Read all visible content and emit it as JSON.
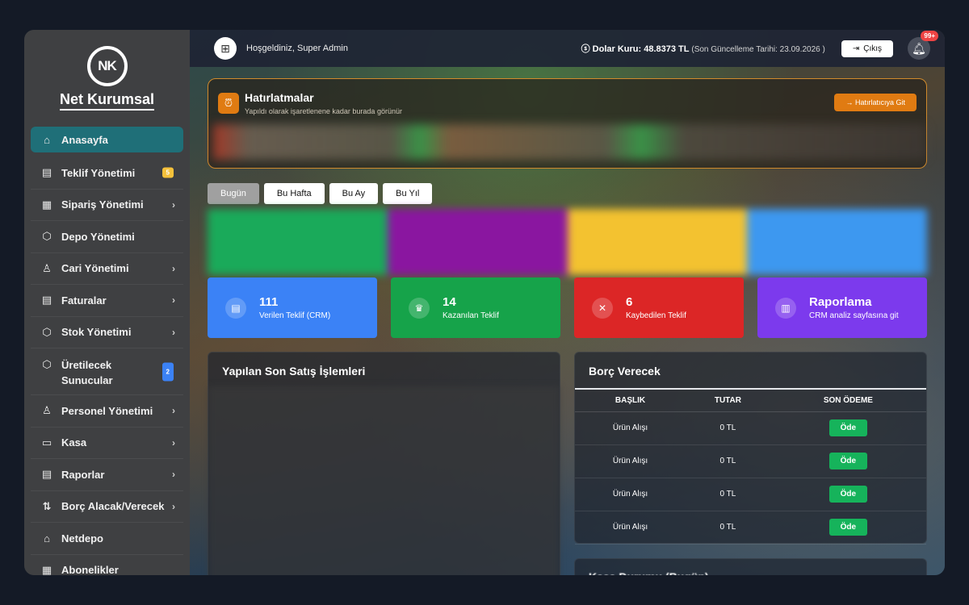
{
  "brand": {
    "logo_initials": "NK",
    "name": "Net Kurumsal"
  },
  "sidebar": {
    "items": [
      {
        "label": "Anasayfa",
        "icon": "home-icon",
        "glyph": "⌂",
        "active": true
      },
      {
        "label": "Teklif Yönetimi",
        "icon": "document-icon",
        "glyph": "▤",
        "badge": "5",
        "badge_color": "yellow"
      },
      {
        "label": "Sipariş Yönetimi",
        "icon": "clipboard-icon",
        "glyph": "▦",
        "chevron": true
      },
      {
        "label": "Depo Yönetimi",
        "icon": "box-icon",
        "glyph": "⬡"
      },
      {
        "label": "Cari Yönetimi",
        "icon": "user-icon",
        "glyph": "♙",
        "chevron": true
      },
      {
        "label": "Faturalar",
        "icon": "invoice-icon",
        "glyph": "▤",
        "chevron": true
      },
      {
        "label": "Stok Yönetimi",
        "icon": "box-icon",
        "glyph": "⬡",
        "chevron": true
      },
      {
        "label": "Üretilecek Sunucular",
        "icon": "cube-icon",
        "glyph": "⬡",
        "badge": "2",
        "badge_color": "blue",
        "tall": true
      },
      {
        "label": "Personel Yönetimi",
        "icon": "users-icon",
        "glyph": "♙",
        "chevron": true
      },
      {
        "label": "Kasa",
        "icon": "wallet-icon",
        "glyph": "▭",
        "chevron": true
      },
      {
        "label": "Raporlar",
        "icon": "report-icon",
        "glyph": "▤",
        "chevron": true
      },
      {
        "label": "Borç Alacak/Verecek",
        "icon": "transfer-icon",
        "glyph": "⇅",
        "chevron": true
      },
      {
        "label": "Netdepo",
        "icon": "store-icon",
        "glyph": "⌂"
      },
      {
        "label": "Abonelikler",
        "icon": "calendar-icon",
        "glyph": "▦"
      }
    ]
  },
  "topbar": {
    "welcome": "Hoşgeldiniz, Super Admin",
    "rate_label": "Dolar Kuru: 48.8373 TL",
    "rate_updated": "(Son Güncelleme Tarihi: 23.09.2026 )",
    "logout": "Çıkış",
    "notification_count": "99+"
  },
  "reminders": {
    "title": "Hatırlatmalar",
    "subtitle": "Yapıldı olarak işaretlenene kadar burada görünür",
    "button": "Hatırlatıcıya Git"
  },
  "filters": [
    "Bugün",
    "Bu Hafta",
    "Bu Ay",
    "Bu Yıl"
  ],
  "active_filter": 0,
  "blurred_cards": [
    "#1aaa5a",
    "#8a16a0",
    "#f3c230",
    "#3d98f0"
  ],
  "stats": [
    {
      "value": "111",
      "label": "Verilen Teklif (CRM)",
      "color": "#3b82f6",
      "icon": "document-icon",
      "glyph": "▤"
    },
    {
      "value": "14",
      "label": "Kazanılan Teklif",
      "color": "#16a34a",
      "icon": "trophy-icon",
      "glyph": "♛"
    },
    {
      "value": "6",
      "label": "Kaybedilen Teklif",
      "color": "#dc2626",
      "icon": "x-circle-icon",
      "glyph": "✕"
    },
    {
      "value": "Raporlama",
      "label": "CRM analiz sayfasına git",
      "color": "#7c3aed",
      "icon": "chart-icon",
      "glyph": "▥"
    }
  ],
  "sales": {
    "title": "Yapılan Son Satış İşlemleri"
  },
  "debt": {
    "title": "Borç Verecek",
    "columns": [
      "BAŞLIK",
      "TUTAR",
      "SON ÖDEME"
    ],
    "rows": [
      {
        "title": "Ürün Alışı",
        "amount": "0 TL",
        "action": "Öde"
      },
      {
        "title": "Ürün Alışı",
        "amount": "0 TL",
        "action": "Öde"
      },
      {
        "title": "Ürün Alışı",
        "amount": "0 TL",
        "action": "Öde"
      },
      {
        "title": "Ürün Alışı",
        "amount": "0 TL",
        "action": "Öde"
      }
    ]
  },
  "cash": {
    "title": "Kasa Durumu (Bugün)"
  }
}
